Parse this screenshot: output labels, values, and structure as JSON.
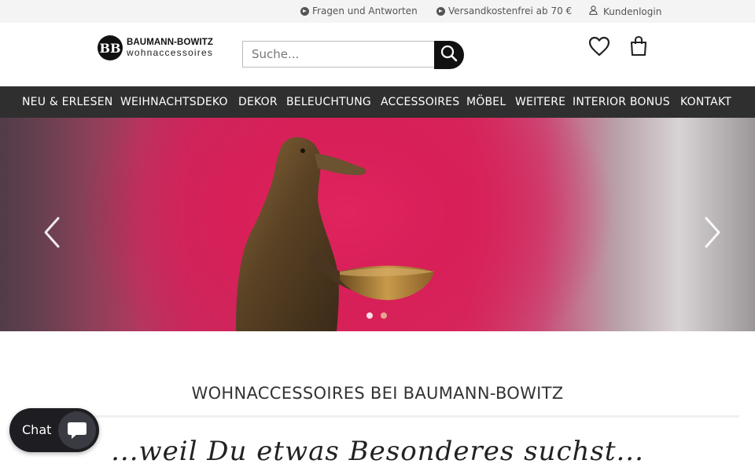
{
  "topbar": {
    "faq_label": "Fragen und Antworten",
    "shipping_label": "Versandkostenfrei ab 70 €",
    "login_label": "Kundenlogin"
  },
  "logo": {
    "line1": "BAUMANN-BOWITZ",
    "line2": "wohnaccessoires",
    "mark": "BB"
  },
  "search": {
    "placeholder": "Suche..."
  },
  "nav": {
    "items": [
      {
        "label": "NEU & ERLESEN"
      },
      {
        "label": "WEIHNACHTSDEKO"
      },
      {
        "label": "DEKOR"
      },
      {
        "label": "BELEUCHTUNG"
      },
      {
        "label": "ACCESSOIRES"
      },
      {
        "label": "MÖBEL"
      },
      {
        "label": "WEITERE"
      },
      {
        "label": "INTERIOR BONUS"
      },
      {
        "label": "KONTAKT"
      }
    ]
  },
  "hero": {
    "slides": 2,
    "active_slide": 1
  },
  "content": {
    "title": "WOHNACCESSOIRES BEI BAUMANN-BOWITZ",
    "tagline": "...weil Du etwas Besonderes suchst..."
  },
  "chat": {
    "label": "Chat"
  },
  "colors": {
    "nav_bg": "#2f2f2f",
    "topbar_bg": "#f4f4f4",
    "hero_accent": "#d6245a",
    "chat_bg": "#1d1d22"
  },
  "icons": [
    "circle-arrow-icon",
    "user-icon",
    "search-icon",
    "heart-icon",
    "shopping-bag-icon",
    "chevron-left-icon",
    "chevron-right-icon",
    "chat-bubble-icon"
  ]
}
